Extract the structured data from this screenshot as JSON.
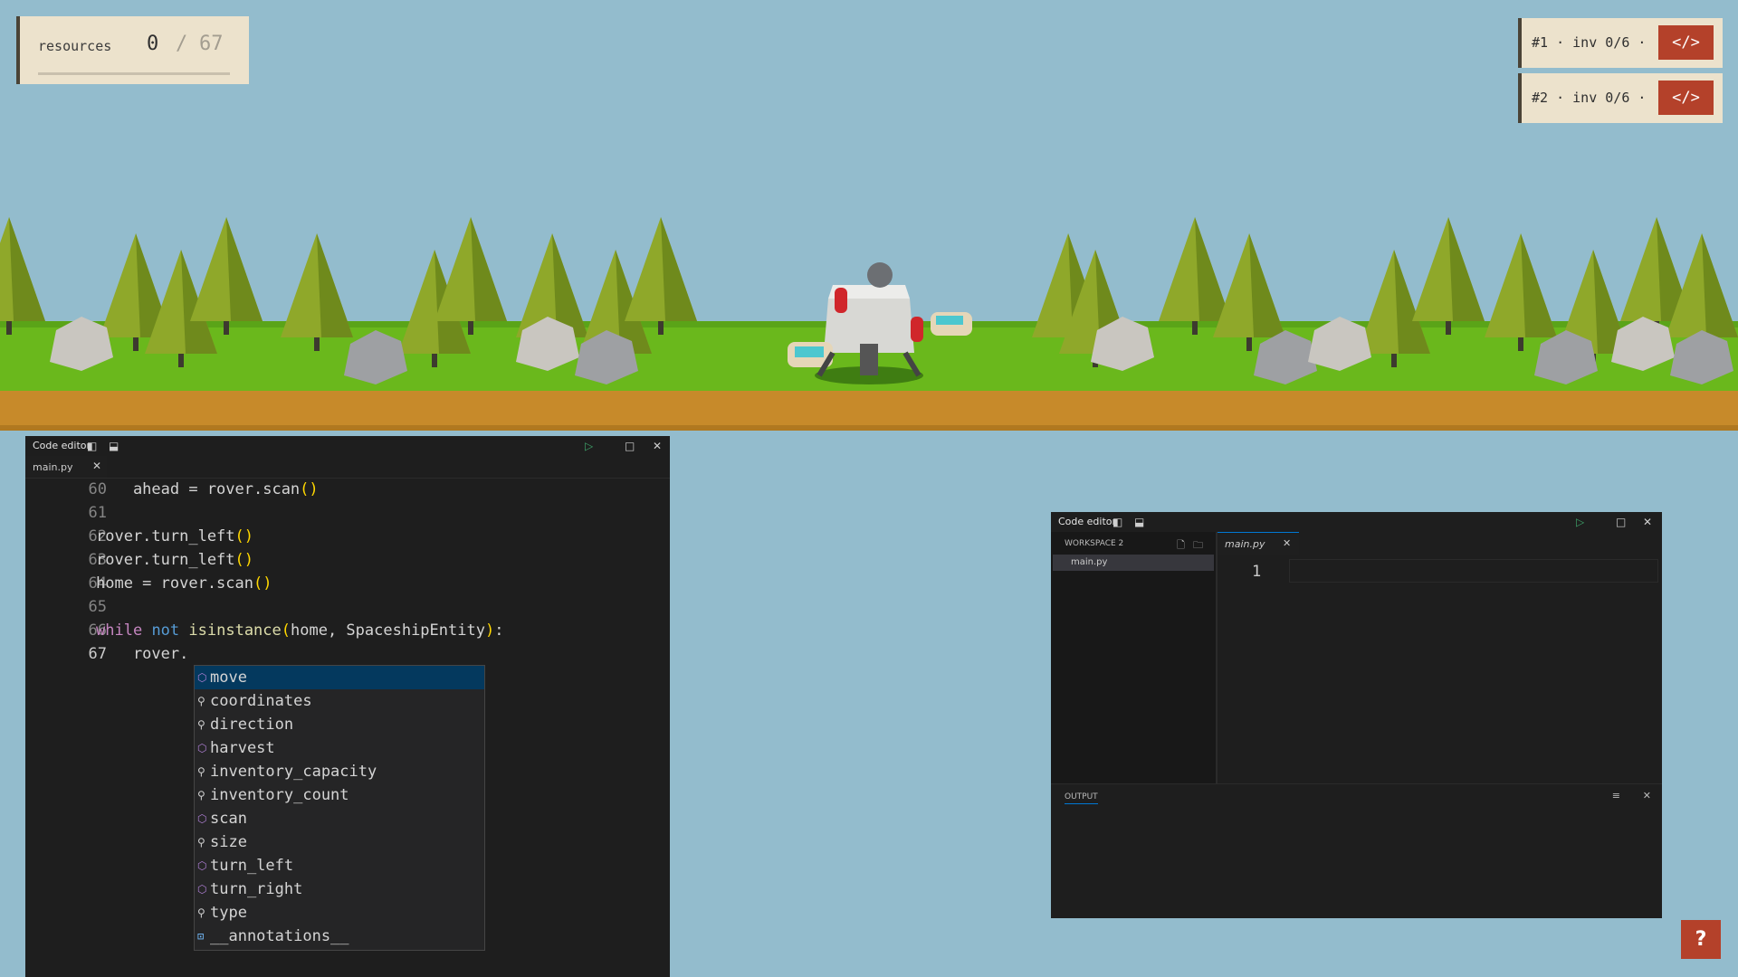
{
  "hud": {
    "resources_label": "resources",
    "resources_current": "0",
    "resources_separator": "/",
    "resources_total": "67",
    "rovers": [
      {
        "label": "#1 · inv 0/6 ·",
        "code_button": "</>"
      },
      {
        "label": "#2 · inv 0/6 ·",
        "code_button": "</>"
      }
    ],
    "help_button": "?"
  },
  "editor1": {
    "title": "Code editor",
    "tab": "main.py",
    "lines": [
      {
        "num": "60",
        "text": "    ahead = rover.scan()"
      },
      {
        "num": "61",
        "text": ""
      },
      {
        "num": "62",
        "text": "rover.turn_left()"
      },
      {
        "num": "63",
        "text": "rover.turn_left()"
      },
      {
        "num": "64",
        "text": "home = rover.scan()"
      },
      {
        "num": "65",
        "text": ""
      },
      {
        "num": "66",
        "text": "while not isinstance(home, SpaceshipEntity):"
      },
      {
        "num": "67",
        "text": "    rover."
      }
    ],
    "suggestions": [
      {
        "label": "move",
        "icon": "method-icon"
      },
      {
        "label": "coordinates",
        "icon": "property-icon"
      },
      {
        "label": "direction",
        "icon": "property-icon"
      },
      {
        "label": "harvest",
        "icon": "method-icon"
      },
      {
        "label": "inventory_capacity",
        "icon": "property-icon"
      },
      {
        "label": "inventory_count",
        "icon": "property-icon"
      },
      {
        "label": "scan",
        "icon": "method-icon"
      },
      {
        "label": "size",
        "icon": "property-icon"
      },
      {
        "label": "turn_left",
        "icon": "method-icon"
      },
      {
        "label": "turn_right",
        "icon": "method-icon"
      },
      {
        "label": "type",
        "icon": "property-icon"
      },
      {
        "label": "__annotations__",
        "icon": "variable-icon"
      }
    ],
    "selected_suggestion": "move"
  },
  "editor2": {
    "title": "Code editor",
    "workspace_label": "WORKSPACE 2",
    "file": "main.py",
    "tab": "main.py",
    "line_number": "1",
    "output_label": "OUTPUT"
  }
}
